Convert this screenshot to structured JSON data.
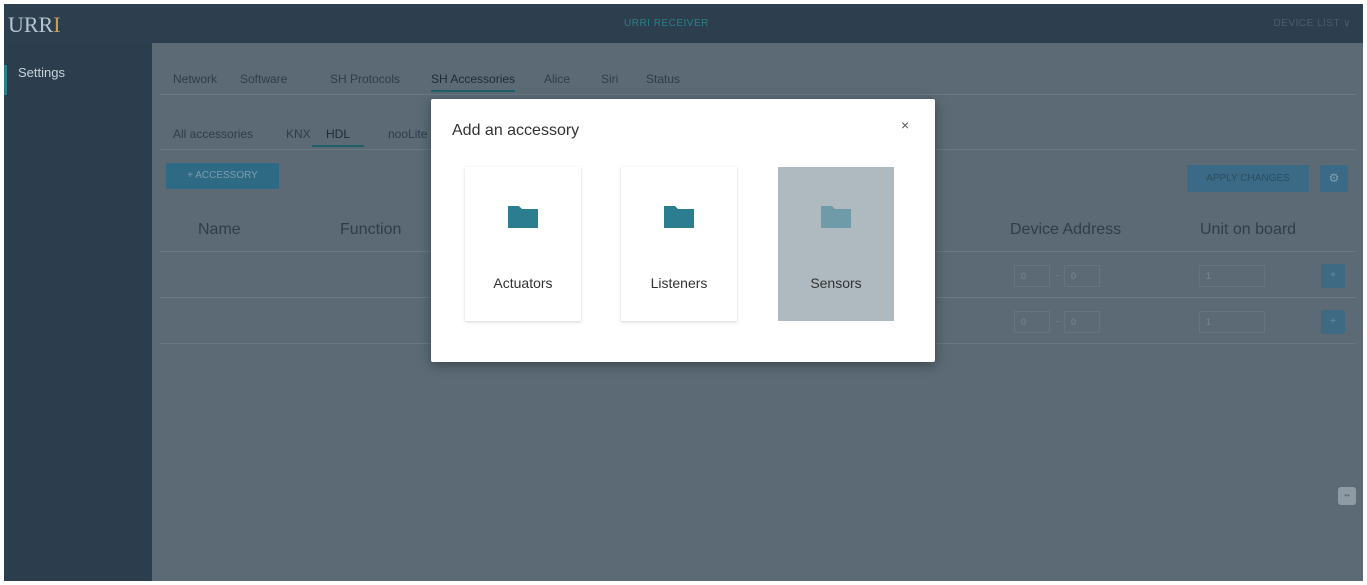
{
  "app": {
    "logo_main": "URR",
    "logo_accent": "I",
    "title": "URRI RECEIVER",
    "device_list": "DEVICE LIST ∨"
  },
  "sidebar": {
    "items": [
      {
        "label": "Settings"
      }
    ]
  },
  "tabs": [
    {
      "label": "Network"
    },
    {
      "label": "Software"
    },
    {
      "label": "SH Protocols"
    },
    {
      "label": "SH Accessories"
    },
    {
      "label": "Alice"
    },
    {
      "label": "Siri"
    },
    {
      "label": "Status"
    }
  ],
  "subtabs": [
    {
      "label": "All accessories"
    },
    {
      "label": "KNX"
    },
    {
      "label": "HDL"
    },
    {
      "label": "nooLite"
    }
  ],
  "toolbar": {
    "add_accessory": "+ ACCESSORY",
    "apply_changes": "APPLY CHANGES",
    "settings_icon": "gear-icon"
  },
  "table": {
    "headers": [
      "Name",
      "Function",
      "Device Address",
      "Unit on board"
    ],
    "rows": [
      {
        "address_a": "0",
        "address_b": "0",
        "unit": "1"
      },
      {
        "address_a": "0",
        "address_b": "0",
        "unit": "1"
      }
    ]
  },
  "modal": {
    "title": "Add an accessory",
    "close_label": "×",
    "options": [
      {
        "label": "Actuators",
        "icon": "folder-icon"
      },
      {
        "label": "Listeners",
        "icon": "folder-icon"
      },
      {
        "label": "Sensors",
        "icon": "folder-icon"
      }
    ]
  },
  "colors": {
    "folder": "#2d7d90",
    "folder_selected": "#6f9aa8",
    "accent": "#2a7f86"
  }
}
